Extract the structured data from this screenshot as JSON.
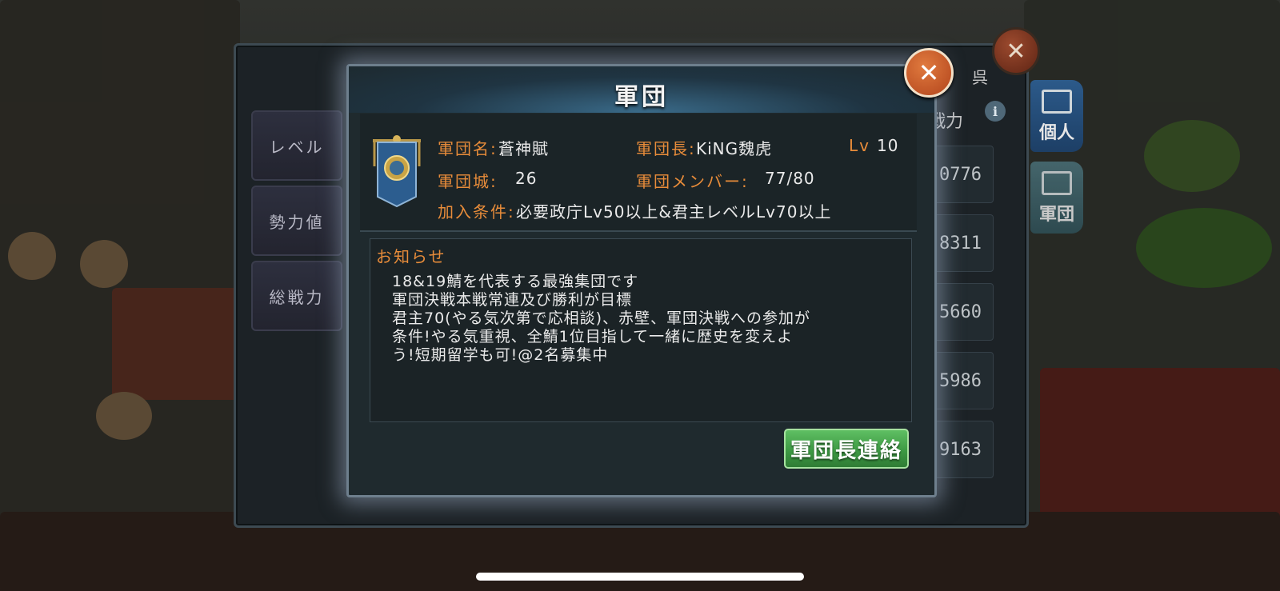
{
  "background": {
    "side_tabs": [
      "レベル",
      "勢力値",
      "総戦力"
    ],
    "faction_label": "呉",
    "power_header": "戦力",
    "power_values": [
      "0776",
      "8311",
      "5660",
      "5986",
      "9163"
    ],
    "right_tabs": [
      "個人",
      "軍団"
    ]
  },
  "modal": {
    "title": "軍団",
    "legion_name_label": "軍団名:",
    "legion_name": "蒼神賦",
    "leader_label": "軍団長:",
    "leader_name": "KiNG魏虎",
    "level_label": "Lv",
    "level_value": "10",
    "castles_label": "軍団城:",
    "castles_value": "26",
    "members_label": "軍団メンバー:",
    "members_value": "77/80",
    "join_label": "加入条件:",
    "join_value": "必要政庁Lv50以上&君主レベルLv70以上",
    "notice_title": "お知らせ",
    "notice_text": "18&19鯖を代表する最強集団です\n軍団決戦本戦常連及び勝利が目標\n君主70(やる気次第で応相談)、赤壁、軍団決戦への参加が\n条件!やる気重視、全鯖1位目指して一緒に歴史を変えよ\nう!短期留学も可!@2名募集中",
    "contact_button": "軍団長連絡"
  },
  "colors": {
    "accent_label": "#e88c3a",
    "button_green": "#3e9a44",
    "close_orange": "#d0622c"
  }
}
